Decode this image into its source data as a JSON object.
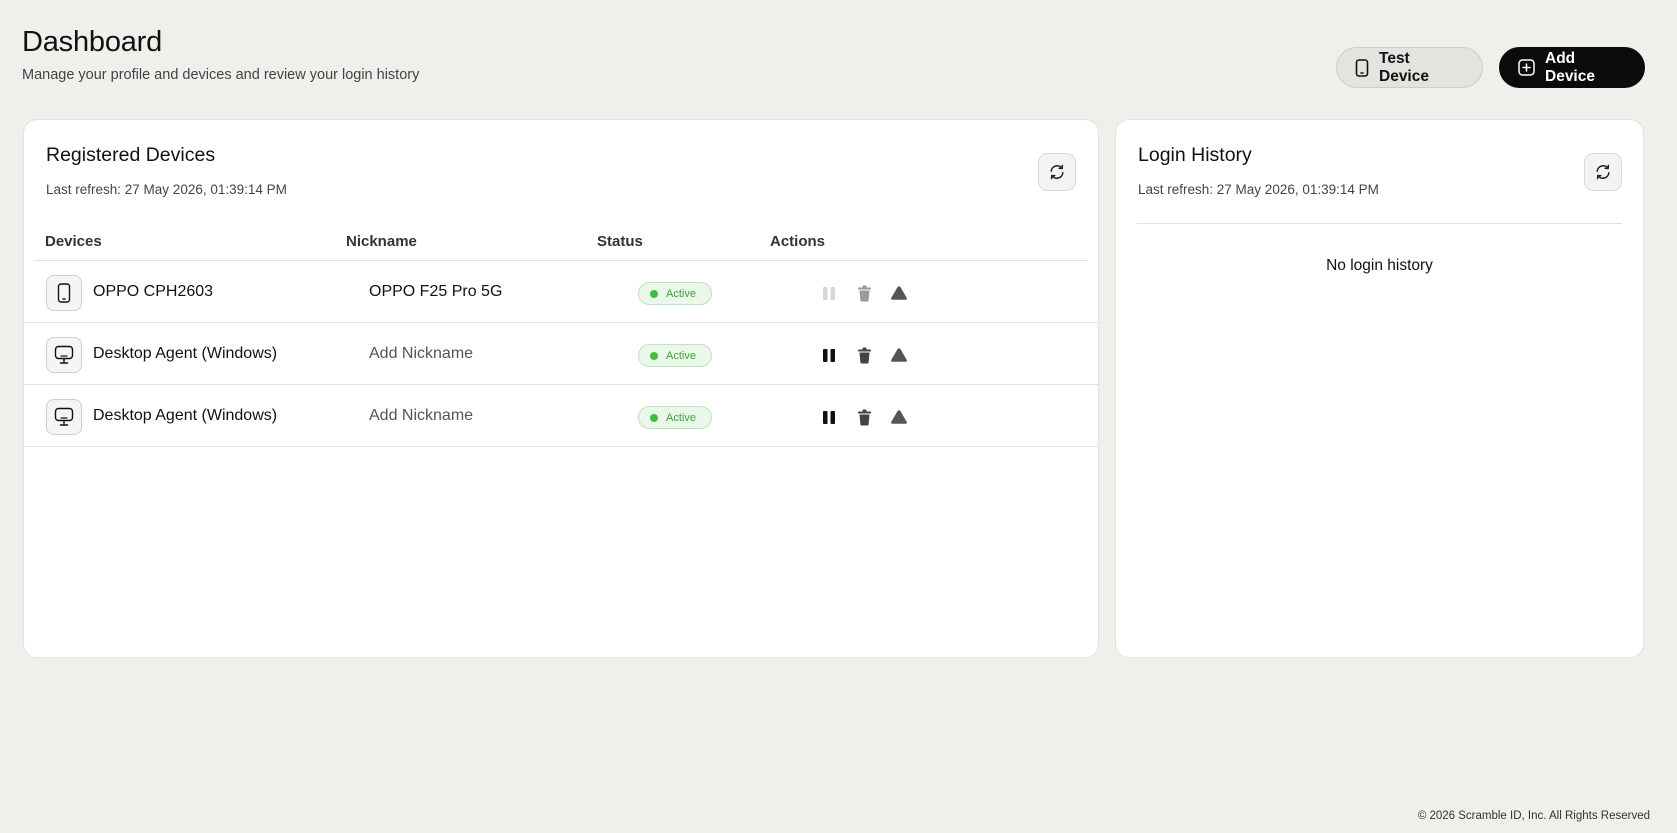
{
  "header": {
    "title": "Dashboard",
    "subtitle": "Manage your profile and devices and review your login history"
  },
  "actions": {
    "test_device": "Test Device",
    "add_device": "Add Device"
  },
  "devices_card": {
    "title": "Registered Devices",
    "last_refresh": "Last refresh: 27 May 2026, 01:39:14 PM",
    "columns": [
      "Devices",
      "Nickname",
      "Status",
      "Actions"
    ],
    "rows": [
      {
        "icon": "phone-icon",
        "name": "OPPO CPH2603",
        "nickname": "OPPO F25 Pro 5G",
        "status": "Active"
      },
      {
        "icon": "monitor-icon",
        "name": "Desktop Agent (Windows)",
        "nickname": "Add Nickname",
        "status": "Active"
      },
      {
        "icon": "monitor-icon",
        "name": "Desktop Agent (Windows)",
        "nickname": "Add Nickname",
        "status": "Active"
      }
    ]
  },
  "history_card": {
    "title": "Login History",
    "last_refresh": "Last refresh: 27 May 2026, 01:39:14 PM",
    "empty_text": "No login history"
  },
  "footer": {
    "copyright": "© 2026 Scramble ID, Inc. All Rights Reserved"
  },
  "colors": {
    "background": "#f0efeb",
    "primary_button": "#0b0b0b",
    "active_status": "#3aa33a"
  }
}
